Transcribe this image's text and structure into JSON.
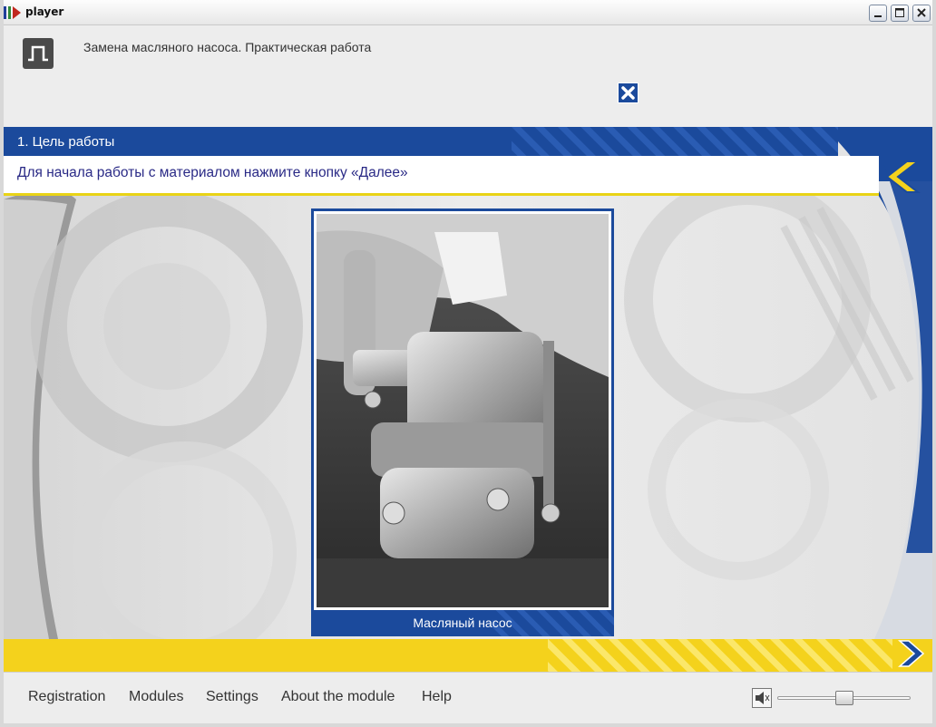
{
  "window": {
    "title": "player",
    "controls": [
      "minimize-icon",
      "maximize-icon",
      "close-icon"
    ]
  },
  "header": {
    "course_title": "Замена масляного насоса. Практическая работа",
    "logo_icon": "course-logo-icon"
  },
  "lesson": {
    "section_title": "1. Цель работы",
    "instruction": "Для начала работы с материалом нажмите кнопку «Далее»",
    "back_icon": "chevron-left-icon",
    "next_icon": "chevron-right-icon"
  },
  "popup": {
    "caption": "Масляный насос",
    "close_icon": "close-icon"
  },
  "menu": {
    "items": [
      "Registration",
      "Modules",
      "Settings",
      "About the module",
      "Help"
    ]
  },
  "volume": {
    "icon": "speaker-icon",
    "level": 0.5
  },
  "colors": {
    "brand_blue": "#1b4a9c",
    "accent_yellow": "#f4d21c",
    "instruction_text": "#2a2a86"
  }
}
